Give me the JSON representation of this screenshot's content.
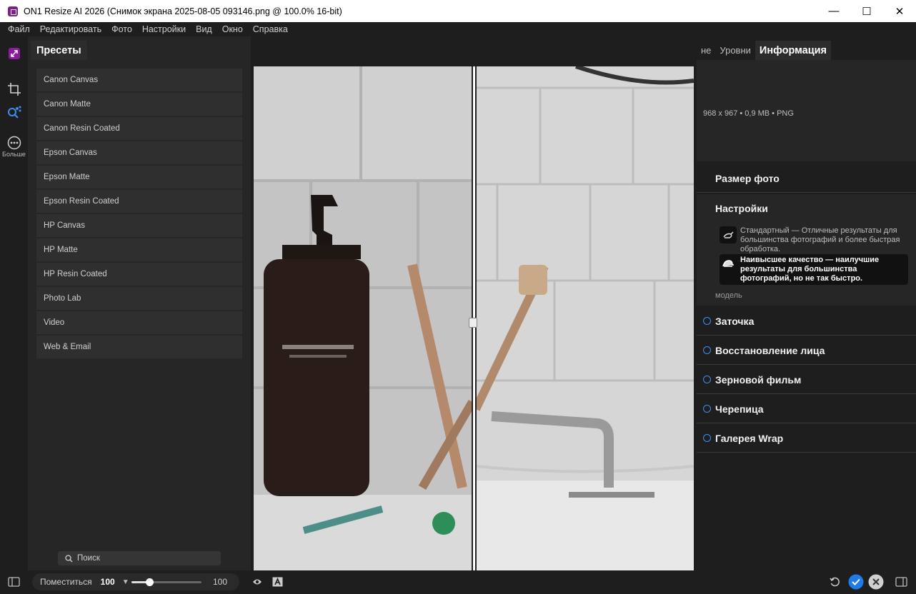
{
  "window": {
    "title": "ON1 Resize AI 2026 (Снимок экрана 2025-08-05 093146.png @ 100.0% 16-bit)",
    "minimize": "—",
    "maximize": "☐",
    "close": "✕"
  },
  "menu": [
    "Файл",
    "Редактировать",
    "Фото",
    "Настройки",
    "Вид",
    "Окно",
    "Справка"
  ],
  "left_tools": {
    "more_label": "Больше"
  },
  "presets": {
    "tab_label": "Пресеты",
    "items": [
      "Canon Canvas",
      "Canon Matte",
      "Canon Resin Coated",
      "Epson Canvas",
      "Epson Matte",
      "Epson Resin Coated",
      "HP Canvas",
      "HP Matte",
      "HP Resin Coated",
      "Photo Lab",
      "Video",
      "Web & Email"
    ],
    "search_placeholder": "Поиск"
  },
  "right_panel": {
    "tabs": [
      "не",
      "Уровни",
      "Информация"
    ],
    "info_meta": "968 x 967 • 0,9 MB • PNG",
    "photo_size": "Размер фото",
    "settings": "Настройки",
    "option_standard": "Стандартный — Отличные результаты для большинства фотографий и более быстрая обработка.",
    "option_best": "Наивысшее качество — наилучшие результаты для большинства фотографий, но не так быстро.",
    "model_label": "модель",
    "sections": [
      "Заточка",
      "Восстановление лица",
      "Зерновой фильм",
      "Черепица",
      "Галерея Wrap"
    ]
  },
  "bottom": {
    "fit_label": "Поместиться",
    "zoom_value": "100",
    "zoom_right": "100",
    "slider_fraction": 0.25
  },
  "colors": {
    "accent": "#3d8ef0",
    "confirm": "#1f7be8"
  }
}
